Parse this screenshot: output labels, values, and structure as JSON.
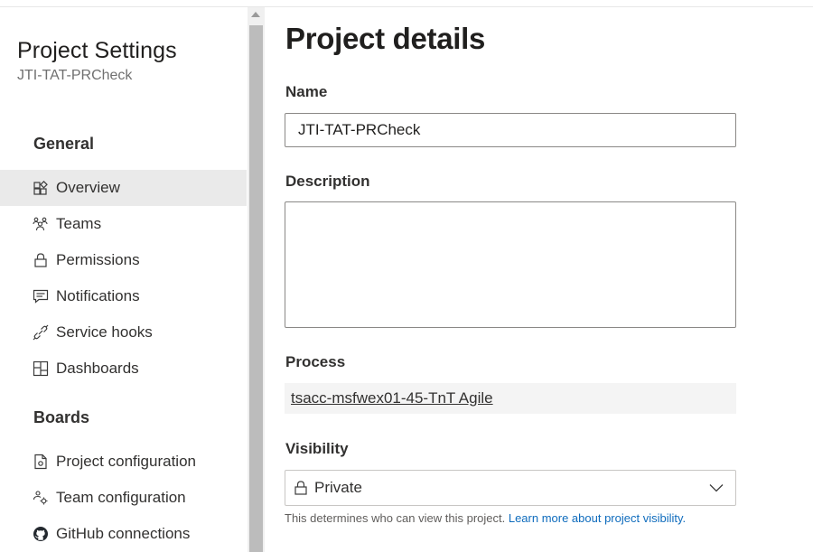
{
  "sidebar": {
    "title": "Project Settings",
    "subtitle": "JTI-TAT-PRCheck",
    "sections": [
      {
        "heading": "General",
        "items": [
          {
            "label": "Overview",
            "icon": "overview-icon",
            "selected": true
          },
          {
            "label": "Teams",
            "icon": "teams-icon"
          },
          {
            "label": "Permissions",
            "icon": "lock-icon"
          },
          {
            "label": "Notifications",
            "icon": "notifications-icon"
          },
          {
            "label": "Service hooks",
            "icon": "service-hooks-icon"
          },
          {
            "label": "Dashboards",
            "icon": "dashboards-icon"
          }
        ]
      },
      {
        "heading": "Boards",
        "items": [
          {
            "label": "Project configuration",
            "icon": "project-configuration-icon"
          },
          {
            "label": "Team configuration",
            "icon": "team-configuration-icon"
          },
          {
            "label": "GitHub connections",
            "icon": "github-icon"
          }
        ]
      }
    ]
  },
  "main": {
    "title": "Project details",
    "name": {
      "label": "Name",
      "value": "JTI-TAT-PRCheck"
    },
    "description": {
      "label": "Description",
      "value": ""
    },
    "process": {
      "label": "Process",
      "value": "tsacc-msfwex01-45-TnT Agile"
    },
    "visibility": {
      "label": "Visibility",
      "value": "Private",
      "help_text": "This determines who can view this project.",
      "help_link": "Learn more about project visibility."
    }
  },
  "colors": {
    "link": "#0f6cbd",
    "selected_bg": "#eaeaea"
  }
}
